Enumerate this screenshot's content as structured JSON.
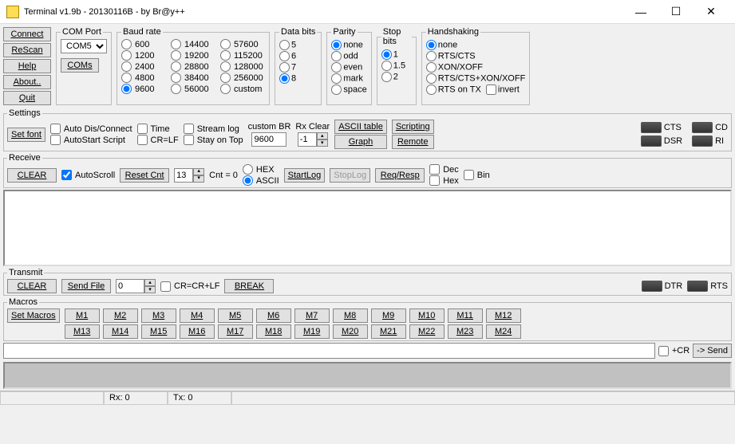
{
  "window": {
    "title": "Terminal v1.9b - 20130116B - by Br@y++"
  },
  "connBtns": {
    "connect": "Connect",
    "rescan": "ReScan",
    "help": "Help",
    "about": "About..",
    "quit": "Quit"
  },
  "comport": {
    "legend": "COM Port",
    "selected": "COM5",
    "btn": "COMs"
  },
  "baud": {
    "legend": "Baud rate",
    "options": [
      "600",
      "1200",
      "2400",
      "4800",
      "9600",
      "14400",
      "19200",
      "28800",
      "38400",
      "56000",
      "57600",
      "115200",
      "128000",
      "256000",
      "custom"
    ],
    "selected": "9600"
  },
  "databits": {
    "legend": "Data bits",
    "options": [
      "5",
      "6",
      "7",
      "8"
    ],
    "selected": "8"
  },
  "parity": {
    "legend": "Parity",
    "options": [
      "none",
      "odd",
      "even",
      "mark",
      "space"
    ],
    "selected": "none"
  },
  "stopbits": {
    "legend": "Stop bits",
    "options": [
      "1",
      "1.5",
      "2"
    ],
    "selected": "1"
  },
  "handshake": {
    "legend": "Handshaking",
    "options": [
      "none",
      "RTS/CTS",
      "XON/XOFF",
      "RTS/CTS+XON/XOFF",
      "RTS on TX"
    ],
    "selected": "none",
    "invert": "invert"
  },
  "settings": {
    "legend": "Settings",
    "setfont": "Set font",
    "autodis": "Auto Dis/Connect",
    "autostart": "AutoStart Script",
    "time": "Time",
    "crlf": "CR=LF",
    "streamlog": "Stream log",
    "stayontop": "Stay on Top",
    "custombr": "custom BR",
    "br_value": "9600",
    "rxclear": "Rx Clear",
    "rxclear_value": "-1",
    "ascii_table": "ASCII table",
    "graph": "Graph",
    "scripting": "Scripting",
    "remote": "Remote",
    "cts": "CTS",
    "cd": "CD",
    "dsr": "DSR",
    "ri": "RI"
  },
  "receive": {
    "legend": "Receive",
    "clear": "CLEAR",
    "autoscroll": "AutoScroll",
    "resetcnt": "Reset Cnt",
    "cnt_n": "13",
    "cnt_label": "Cnt = 0",
    "hex": "HEX",
    "ascii": "ASCII",
    "startlog": "StartLog",
    "stoplog": "StopLog",
    "reqresp": "Req/Resp",
    "dec": "Dec",
    "hexchk": "Hex",
    "bin": "Bin"
  },
  "transmit": {
    "legend": "Transmit",
    "clear": "CLEAR",
    "sendfile": "Send File",
    "num": "0",
    "crcrlf": "CR=CR+LF",
    "break": "BREAK",
    "dtr": "DTR",
    "rts": "RTS"
  },
  "macros": {
    "legend": "Macros",
    "setmacros": "Set Macros",
    "m": [
      "M1",
      "M2",
      "M3",
      "M4",
      "M5",
      "M6",
      "M7",
      "M8",
      "M9",
      "M10",
      "M11",
      "M12",
      "M13",
      "M14",
      "M15",
      "M16",
      "M17",
      "M18",
      "M19",
      "M20",
      "M21",
      "M22",
      "M23",
      "M24"
    ]
  },
  "sendline": {
    "cr": "+CR",
    "send": "-> Send"
  },
  "status": {
    "rx": "Rx: 0",
    "tx": "Tx: 0"
  }
}
